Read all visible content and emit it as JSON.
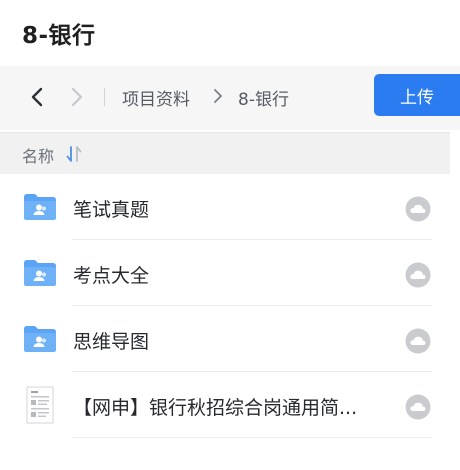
{
  "header": {
    "title": "8-银行"
  },
  "nav": {
    "back_icon": "chevron-left-icon",
    "forward_icon": "chevron-right-icon",
    "breadcrumb": {
      "root": "项目资料",
      "current": "8-银行"
    },
    "upload_label": "上传"
  },
  "list_header": {
    "name_label": "名称",
    "sort_icon": "sort-icon"
  },
  "files": [
    {
      "name": "笔试真题",
      "type": "shared-folder",
      "sync_icon": "cloud-icon"
    },
    {
      "name": "考点大全",
      "type": "shared-folder",
      "sync_icon": "cloud-icon"
    },
    {
      "name": "思维导图",
      "type": "shared-folder",
      "sync_icon": "cloud-icon"
    },
    {
      "name": "【网申】银行秋招综合岗通用简...",
      "type": "document",
      "sync_icon": "cloud-icon"
    }
  ],
  "colors": {
    "accent": "#2a7cf0",
    "folder": "#5aa3f5",
    "cloud": "#c9cbcf"
  }
}
